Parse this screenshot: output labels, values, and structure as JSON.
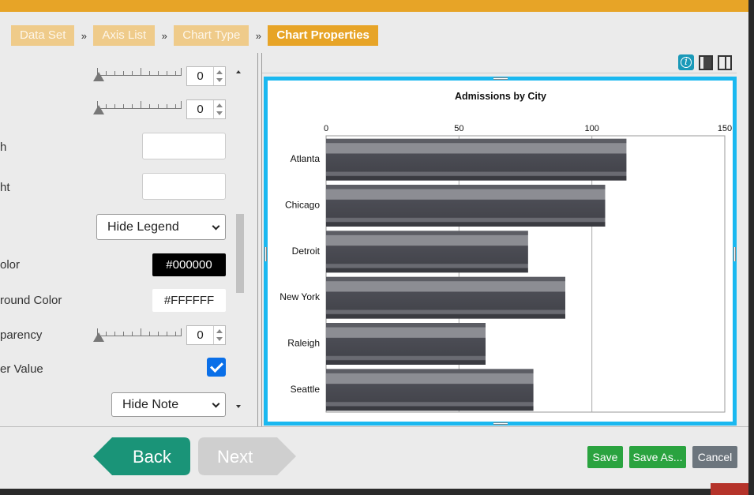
{
  "breadcrumbs": {
    "step1": "Data Set",
    "step2": "Axis List",
    "step3": "Chart Type",
    "step4": "Chart Properties",
    "separator": "»"
  },
  "properties": {
    "slider1_value": "0",
    "slider2_value": "0",
    "width_label": "h",
    "height_label": "ht",
    "legend_select": "Hide Legend",
    "color_label": "olor",
    "color_value": "#000000",
    "background_label": "round Color",
    "background_value": "#FFFFFF",
    "transparency_label": "parency",
    "transparency_value": "0",
    "value_label": "er Value",
    "value_checked": true,
    "note_select": "Hide Note"
  },
  "toolbar": {
    "info_icon": "info-icon",
    "info_glyph": "i"
  },
  "chart_data": {
    "type": "bar",
    "orientation": "horizontal",
    "title": "Admissions by City",
    "categories": [
      "Atlanta",
      "Chicago",
      "Detroit",
      "New York",
      "Raleigh",
      "Seattle"
    ],
    "values": [
      113,
      105,
      76,
      90,
      60,
      78
    ],
    "xlim": [
      0,
      150
    ],
    "xticks": [
      0,
      50,
      100,
      150
    ],
    "grid": true,
    "legend": "none",
    "bar_color": "#4a4b52"
  },
  "footer": {
    "back_label": "Back",
    "next_label": "Next",
    "save_label": "Save",
    "save_as_label": "Save As...",
    "cancel_label": "Cancel"
  },
  "colors": {
    "accent": "#e7a427",
    "back_green": "#1a9478",
    "save_green": "#2aa33f",
    "chart_border": "#1ab8f0"
  }
}
